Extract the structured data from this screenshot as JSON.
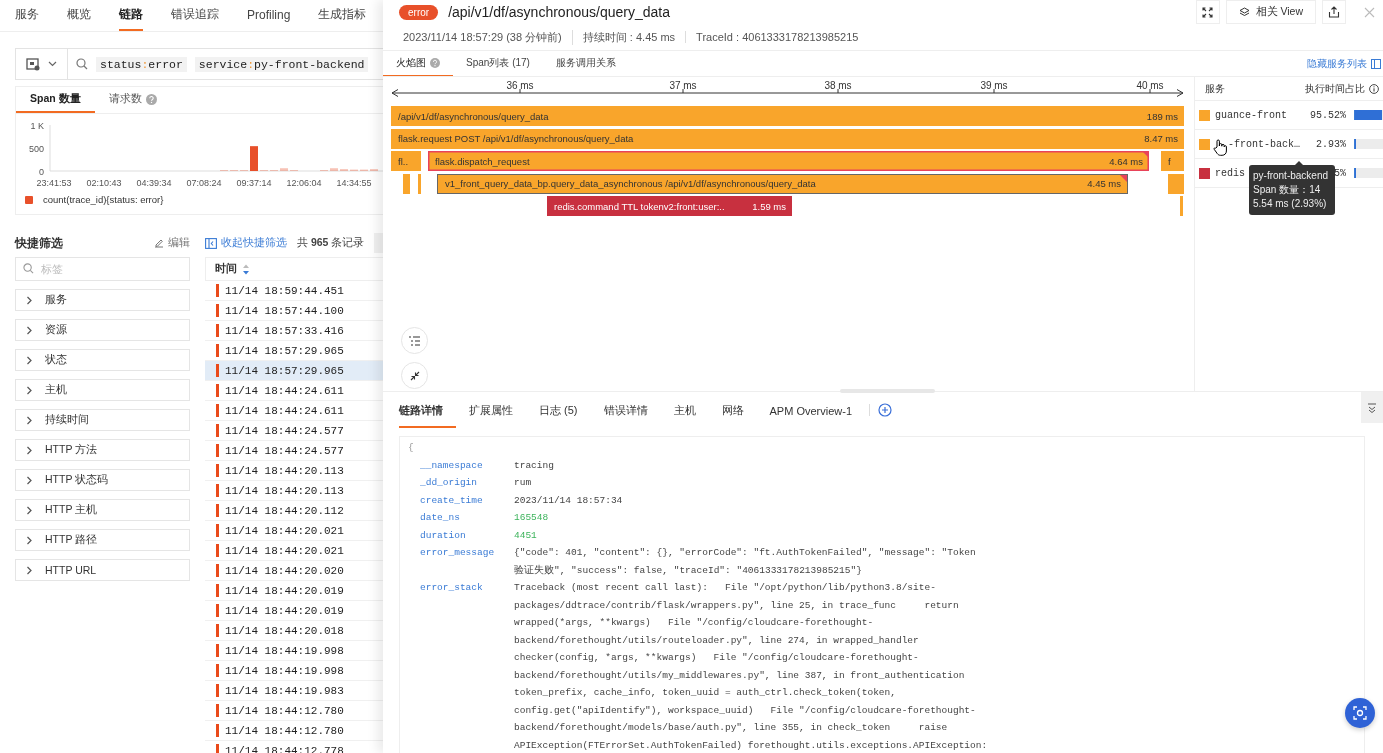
{
  "nav": {
    "tabs": [
      {
        "label": "服务",
        "selected": false
      },
      {
        "label": "概览",
        "selected": false
      },
      {
        "label": "链路",
        "selected": true
      },
      {
        "label": "错误追踪",
        "selected": false
      },
      {
        "label": "Profiling",
        "selected": false
      },
      {
        "label": "生成指标",
        "selected": false
      }
    ]
  },
  "query": {
    "tags": [
      {
        "key": "status",
        "sep": ":",
        "value": "error"
      },
      {
        "key": "service",
        "sep": ":",
        "value": "py-front-backend"
      }
    ]
  },
  "stats": {
    "tabs": [
      {
        "label": "Span 数量",
        "selected": true,
        "help": false
      },
      {
        "label": "请求数",
        "selected": false,
        "help": true
      }
    ],
    "chart_data": {
      "type": "bar",
      "categories": [
        "23:41:53",
        null,
        null,
        null,
        null,
        "02:10:43",
        null,
        null,
        null,
        null,
        "04:39:34",
        null,
        null,
        null,
        null,
        "07:08:24",
        null,
        null,
        null,
        null,
        "09:37:14",
        null,
        null,
        null,
        null,
        "12:06:04",
        null,
        null,
        null,
        null,
        "14:34:55",
        null,
        null
      ],
      "yticks": [
        0,
        500,
        {
          "value": 1000,
          "label": "1 K"
        }
      ],
      "ylim": [
        0,
        1000
      ],
      "series": [
        {
          "name": "count(trace_id){status: error}",
          "color": "#e8502a",
          "values": [
            0,
            0,
            0,
            0,
            0,
            0,
            0,
            0,
            0,
            0,
            0,
            0,
            0,
            0,
            0,
            0,
            0,
            20,
            20,
            20,
            540,
            20,
            20,
            60,
            20,
            0,
            0,
            20,
            60,
            40,
            30,
            30,
            40
          ]
        }
      ]
    }
  },
  "filters": {
    "title": "快捷筛选",
    "edit": "编辑",
    "placeholder": "标签",
    "items": [
      {
        "label": "服务",
        "expanded": false
      },
      {
        "label": "资源",
        "expanded": false
      },
      {
        "label": "状态",
        "expanded": false
      },
      {
        "label": "主机",
        "expanded": false
      },
      {
        "label": "持续时间",
        "expanded": false
      },
      {
        "label": "HTTP 方法",
        "expanded": false
      },
      {
        "label": "HTTP 状态码",
        "expanded": false
      },
      {
        "label": "HTTP 主机",
        "expanded": false
      },
      {
        "label": "HTTP 路径",
        "expanded": false
      },
      {
        "label": "HTTP URL",
        "expanded": false
      }
    ]
  },
  "list": {
    "collapse": "收起快捷筛选",
    "total": "共 **965** 条记录",
    "column": {
      "label": "时间",
      "sort_descending": true
    },
    "rows": [
      {
        "time": "11/14 18:59:44.451",
        "selected": false
      },
      {
        "time": "11/14 18:57:44.100",
        "selected": false
      },
      {
        "time": "11/14 18:57:33.416",
        "selected": false
      },
      {
        "time": "11/14 18:57:29.965",
        "selected": false
      },
      {
        "time": "11/14 18:57:29.965",
        "selected": true
      },
      {
        "time": "11/14 18:44:24.611",
        "selected": false
      },
      {
        "time": "11/14 18:44:24.611",
        "selected": false
      },
      {
        "time": "11/14 18:44:24.577",
        "selected": false
      },
      {
        "time": "11/14 18:44:24.577",
        "selected": false
      },
      {
        "time": "11/14 18:44:20.113",
        "selected": false
      },
      {
        "time": "11/14 18:44:20.113",
        "selected": false
      },
      {
        "time": "11/14 18:44:20.112",
        "selected": false
      },
      {
        "time": "11/14 18:44:20.021",
        "selected": false
      },
      {
        "time": "11/14 18:44:20.021",
        "selected": false
      },
      {
        "time": "11/14 18:44:20.020",
        "selected": false
      },
      {
        "time": "11/14 18:44:20.019",
        "selected": false
      },
      {
        "time": "11/14 18:44:20.019",
        "selected": false
      },
      {
        "time": "11/14 18:44:20.018",
        "selected": false
      },
      {
        "time": "11/14 18:44:19.998",
        "selected": false
      },
      {
        "time": "11/14 18:44:19.998",
        "selected": false
      },
      {
        "time": "11/14 18:44:19.983",
        "selected": false
      },
      {
        "time": "11/14 18:44:12.780",
        "selected": false
      },
      {
        "time": "11/14 18:44:12.780",
        "selected": false
      },
      {
        "time": "11/14 18:44:12.778",
        "selected": false
      }
    ]
  },
  "drawer": {
    "status": {
      "label": "error",
      "kind": "error"
    },
    "title": "/api/v1/df/asynchronous/query_data",
    "related": "相关 View",
    "meta": [
      "2023/11/14 18:57:29 (38 分钟前)",
      "持续时间 : 4.45 ms",
      "TraceId : 4061333178213985215"
    ],
    "tabs": [
      {
        "label": "火焰图",
        "selected": true,
        "help": true
      },
      {
        "label": "Span列表 (17)",
        "selected": false,
        "help": false
      },
      {
        "label": "服务调用关系",
        "selected": false,
        "help": false
      }
    ],
    "hide_services": "隐藏服务列表",
    "flame": {
      "axis": [
        "36 ms",
        "37 ms",
        "38 ms",
        "39 ms",
        "40 ms"
      ],
      "spans": [
        {
          "label": "/api/v1/df/asynchronous/query_data",
          "duration": "189 ms",
          "color": "#f9a52b",
          "error": false,
          "highlighted": false,
          "selected": false,
          "children": [
            {
              "label": "flask.request POST /api/v1/df/asynchronous/query_data",
              "duration": "8.47 ms",
              "color": "#f9a52b",
              "error": false,
              "highlighted": false,
              "selected": false,
              "children": [
                {
                  "label": "fl..",
                  "color": "#f9a52b",
                  "error": false,
                  "highlighted": false,
                  "selected": false,
                  "children": [
                    {
                      "color": "#f9a52b",
                      "error": false,
                      "highlighted": false,
                      "selected": false
                    },
                    {
                      "color": "#f9a52b",
                      "error": false,
                      "highlighted": false,
                      "selected": false
                    }
                  ]
                },
                {
                  "label": "flask.dispatch_request",
                  "duration": "4.64 ms",
                  "color": "#f9a52b",
                  "error": true,
                  "highlighted": true,
                  "selected": false,
                  "children": [
                    {
                      "label": "v1_front_query_data_bp.query_data_asynchronous /api/v1/df/asynchronous/query_data",
                      "duration": "4.45 ms",
                      "color": "#f9a52b",
                      "error": true,
                      "highlighted": false,
                      "selected": true,
                      "children": [
                        {
                          "label": "redis.command TTL tokenv2:front:user:..",
                          "duration": "1.59 ms",
                          "color": "#c8303f",
                          "error": false,
                          "highlighted": false,
                          "selected": false
                        }
                      ]
                    }
                  ]
                },
                {
                  "label": "f",
                  "color": "#f9a52b",
                  "error": false,
                  "highlighted": false,
                  "selected": false,
                  "children": [
                    {
                      "color": "#f9a52b",
                      "error": false,
                      "highlighted": false,
                      "selected": false,
                      "children": [
                        {
                          "color": "#f9a52b",
                          "error": false,
                          "highlighted": false,
                          "selected": false
                        }
                      ]
                    }
                  ]
                }
              ]
            }
          ]
        }
      ]
    },
    "services": {
      "columns": [
        "服务",
        "执行时间占比"
      ],
      "rows": [
        {
          "name": "guance-front",
          "color": "#f9a52b",
          "share": "95.52%",
          "level": 0.9552,
          "hovered": false
        },
        {
          "name": "-front-back…",
          "color": "#f9a52b",
          "share": "2.93%",
          "level": 0.0293,
          "hovered": true
        },
        {
          "name": "redis",
          "color": "#c8303f",
          "share": "5%",
          "level": 0.015,
          "hovered": false
        }
      ],
      "tooltip": {
        "title": "py-front-backend",
        "lines": [
          "Span 数量：14",
          "5.54 ms (2.93%)"
        ]
      }
    },
    "detail_tabs": [
      {
        "label": "链路详情",
        "selected": true
      },
      {
        "label": "扩展属性",
        "selected": false
      },
      {
        "label": "日志 (5)",
        "selected": false
      },
      {
        "label": "错误详情",
        "selected": false
      },
      {
        "label": "主机",
        "selected": false
      },
      {
        "label": "网络",
        "selected": false
      },
      {
        "label": "APM Overview-1",
        "selected": false
      }
    ],
    "brace": "{",
    "fields": [
      {
        "key": "__namespace",
        "kind": "text",
        "lines": [
          "tracing"
        ]
      },
      {
        "key": "_dd_origin",
        "kind": "text",
        "lines": [
          "rum"
        ]
      },
      {
        "key": "create_time",
        "kind": "text",
        "lines": [
          "2023/11/14 18:57:34"
        ]
      },
      {
        "key": "date_ns",
        "kind": "number",
        "lines": [
          "165548"
        ]
      },
      {
        "key": "duration",
        "kind": "number",
        "lines": [
          "4451"
        ]
      },
      {
        "key": "error_message",
        "kind": "text",
        "lines": [
          "{\"code\": 401, \"content\": {}, \"errorCode\": \"ft.AuthTokenFailed\", \"message\": \"Token",
          "验证失败\", \"success\": false, \"traceId\": \"4061333178213985215\"}"
        ]
      },
      {
        "key": "error_stack",
        "kind": "text",
        "lines": [
          "Traceback (most recent call last):   File \"/opt/python/lib/python3.8/site-",
          "packages/ddtrace/contrib/flask/wrappers.py\", line 25, in trace_func     return",
          "wrapped(*args, **kwargs)   File \"/config/cloudcare-forethought-",
          "backend/forethought/utils/routeloader.py\", line 274, in wrapped_handler",
          "checker(config, *args, **kwargs)   File \"/config/cloudcare-forethought-",
          "backend/forethought/utils/my_middlewares.py\", line 387, in front_authentication",
          "token_prefix, cache_info, token_uuid = auth_ctrl.check_token(token,",
          "config.get(\"apiIdentify\"), workspace_uuid)   File \"/config/cloudcare-forethought-",
          "backend/forethought/models/base/auth.py\", line 355, in check_token     raise",
          "APIException(FTErrorSet.AuthTokenFailed) forethought.utils.exceptions.APIException:"
        ]
      }
    ]
  }
}
